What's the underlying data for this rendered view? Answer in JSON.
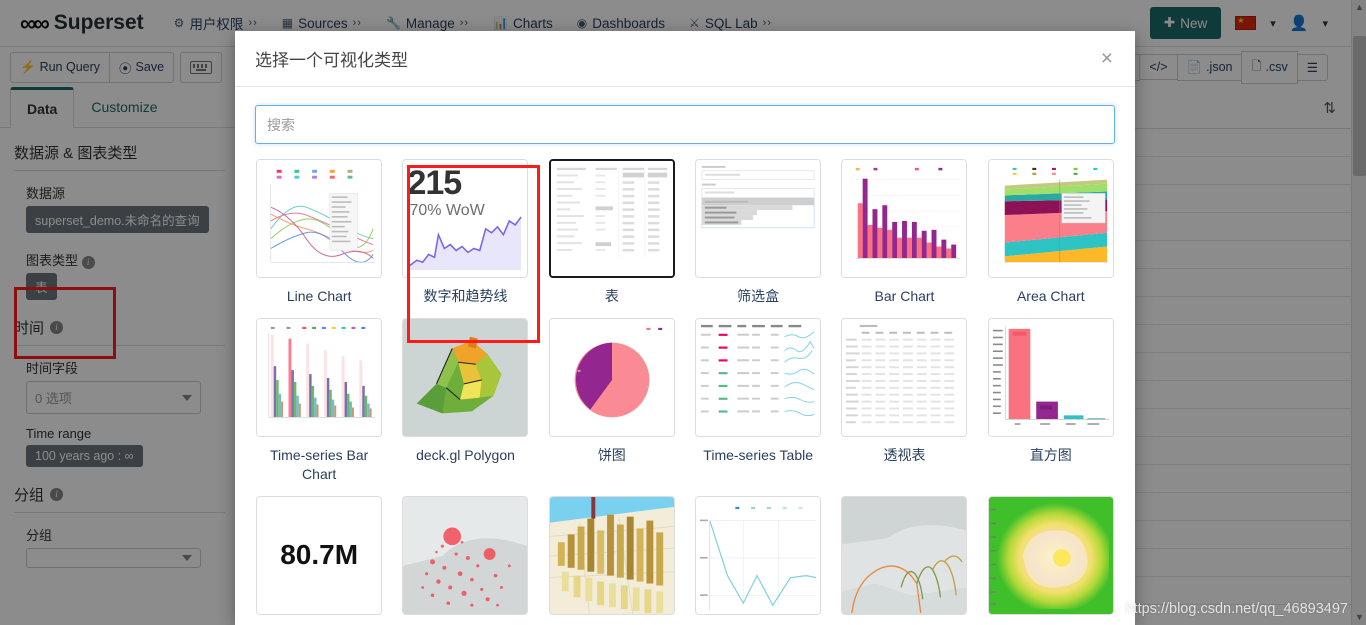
{
  "navbar": {
    "brand": "Superset",
    "brand_logo_icon": "infinity-logo-icon",
    "items": [
      {
        "label": "用户权限",
        "icon": "gears-icon",
        "has_dropdown": true
      },
      {
        "label": "Sources",
        "icon": "table-icon",
        "has_dropdown": true
      },
      {
        "label": "Manage",
        "icon": "wrench-icon",
        "has_dropdown": true
      },
      {
        "label": "Charts",
        "icon": "bar-chart-icon",
        "has_dropdown": false
      },
      {
        "label": "Dashboards",
        "icon": "dashboard-icon",
        "has_dropdown": false
      },
      {
        "label": "SQL Lab",
        "icon": "flask-icon",
        "has_dropdown": true
      }
    ],
    "new_button": "New",
    "new_button_icon": "plus-icon",
    "new_button_color": "#1a6b68",
    "language_icon": "china-flag-icon",
    "user_icon": "user-icon",
    "chevron_icon": "chevron-down-icon"
  },
  "query_toolbar": {
    "run_query": "Run Query",
    "run_query_icon": "bolt-icon",
    "save": "Save",
    "save_icon": "save-circle-icon",
    "keyboard_icon": "keyboard-icon",
    "right_buttons": [
      {
        "label": "",
        "icon": "link-icon"
      },
      {
        "label": "",
        "icon": "code-icon"
      },
      {
        "label": ".json",
        "icon": "json-file-icon"
      },
      {
        "label": ".csv",
        "icon": "csv-file-icon"
      },
      {
        "label": "",
        "icon": "hamburger-icon"
      }
    ]
  },
  "sidebar": {
    "tabs": [
      {
        "label": "Data",
        "active": true
      },
      {
        "label": "Customize",
        "active": false
      }
    ],
    "sections": [
      {
        "title": "数据源 & 图表类型",
        "has_info": false,
        "fields": [
          {
            "label": "数据源",
            "value": "superset_demo.未命名的查询",
            "type": "pill"
          },
          {
            "label": "图表类型",
            "value": "表",
            "type": "pill",
            "has_info": true,
            "highlighted": true
          }
        ]
      },
      {
        "title": "时间",
        "has_info": true,
        "fields": [
          {
            "label": "时间字段",
            "value": "0 选项",
            "type": "select"
          },
          {
            "label": "Time range",
            "value": "100 years ago : ∞",
            "type": "pill"
          }
        ]
      },
      {
        "title": "分组",
        "has_info": true,
        "fields": [
          {
            "label": "分组",
            "value": "",
            "type": "select"
          }
        ]
      }
    ]
  },
  "modal": {
    "title": "选择一个可视化类型",
    "close_icon": "close-icon",
    "search_placeholder": "搜索",
    "search_value": "",
    "viz_types": [
      {
        "label": "Line Chart",
        "thumb": "line-chart-thumb",
        "selected": false,
        "annotated": false
      },
      {
        "label": "数字和趋势线",
        "thumb": "big-number-trendline-thumb",
        "selected": false,
        "annotated": true,
        "thumb_text": {
          "big": "215",
          "sub": "70% WoW"
        }
      },
      {
        "label": "表",
        "thumb": "table-thumb",
        "selected": true,
        "annotated": false
      },
      {
        "label": "筛选盒",
        "thumb": "filter-box-thumb",
        "selected": false,
        "annotated": false
      },
      {
        "label": "Bar Chart",
        "thumb": "bar-chart-thumb",
        "selected": false,
        "annotated": false
      },
      {
        "label": "Area Chart",
        "thumb": "area-chart-thumb",
        "selected": false,
        "annotated": false
      },
      {
        "label": "Time-series Bar Chart",
        "thumb": "timeseries-bar-thumb",
        "selected": false,
        "annotated": false
      },
      {
        "label": "deck.gl Polygon",
        "thumb": "deckgl-polygon-thumb",
        "selected": false,
        "annotated": false
      },
      {
        "label": "饼图",
        "thumb": "pie-chart-thumb",
        "selected": false,
        "annotated": false
      },
      {
        "label": "Time-series Table",
        "thumb": "timeseries-table-thumb",
        "selected": false,
        "annotated": false
      },
      {
        "label": "透视表",
        "thumb": "pivot-table-thumb",
        "selected": false,
        "annotated": false
      },
      {
        "label": "直方图",
        "thumb": "histogram-thumb",
        "selected": false,
        "annotated": false
      },
      {
        "label": "",
        "thumb": "big-number-thumb",
        "selected": false,
        "annotated": false,
        "thumb_text": {
          "big": "80.7M"
        }
      },
      {
        "label": "",
        "thumb": "deckgl-scatter-thumb",
        "selected": false,
        "annotated": false
      },
      {
        "label": "",
        "thumb": "deckgl-grid-thumb",
        "selected": false,
        "annotated": false
      },
      {
        "label": "",
        "thumb": "line-sparse-thumb",
        "selected": false,
        "annotated": false
      },
      {
        "label": "",
        "thumb": "deckgl-arc-thumb",
        "selected": false,
        "annotated": false
      },
      {
        "label": "",
        "thumb": "heatmap-thumb",
        "selected": false,
        "annotated": false
      }
    ]
  },
  "annotation": {
    "color": "#ff1a1a"
  },
  "watermark": "https://blog.csdn.net/qq_46893497"
}
